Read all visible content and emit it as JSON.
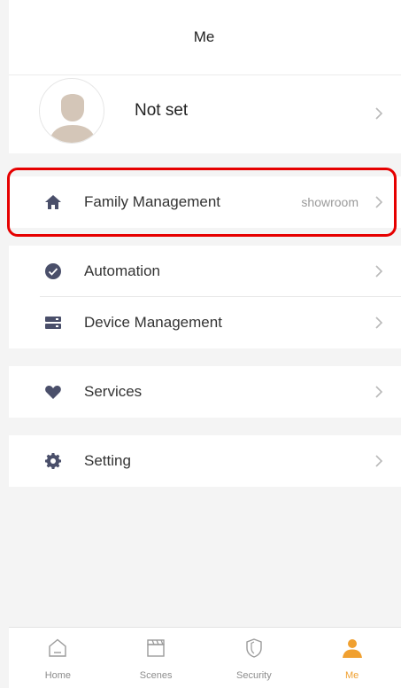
{
  "header": {
    "title": "Me"
  },
  "profile": {
    "name": "Not set"
  },
  "menu": {
    "family": {
      "label": "Family Management",
      "value": "showroom"
    },
    "automation": {
      "label": "Automation"
    },
    "device": {
      "label": "Device Management"
    },
    "services": {
      "label": "Services"
    },
    "setting": {
      "label": "Setting"
    }
  },
  "tabbar": {
    "tabs": [
      {
        "label": "Home",
        "icon": "home-outline-icon",
        "active": false
      },
      {
        "label": "Scenes",
        "icon": "clapperboard-icon",
        "active": false
      },
      {
        "label": "Security",
        "icon": "shield-icon",
        "active": false
      },
      {
        "label": "Me",
        "icon": "person-icon",
        "active": true
      }
    ]
  },
  "colors": {
    "accent": "#f0a030",
    "highlight": "#e60000",
    "icon": "#4a4f6a",
    "background": "#f4f4f4"
  }
}
